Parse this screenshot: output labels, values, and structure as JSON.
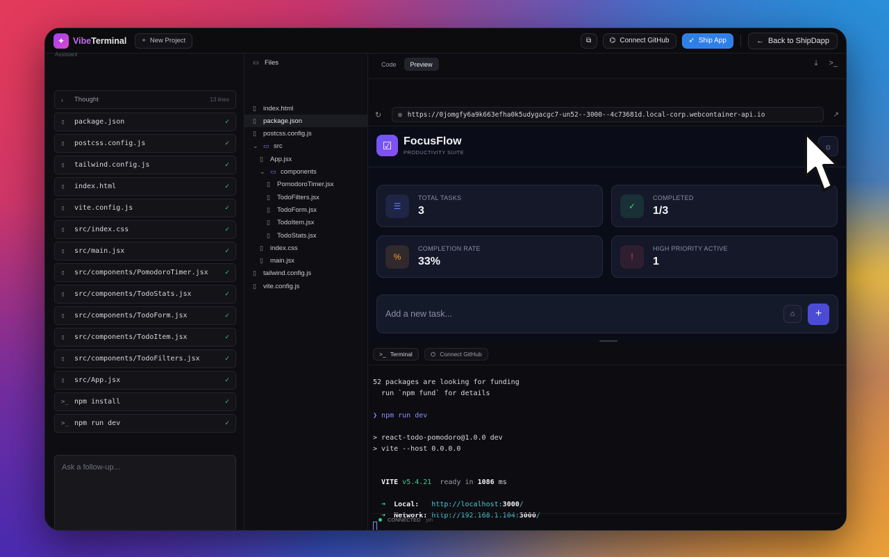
{
  "app": {
    "brand_prefix": "Vibe",
    "brand_suffix": "Terminal",
    "new_project": "New Project",
    "connect_github": "Connect GitHub",
    "ship_app": "Ship App",
    "back": "Back to ShipDapp"
  },
  "assistant": {
    "header": "Assistant",
    "thought_label": "Thought",
    "thought_lines": "13 lines",
    "items": [
      {
        "label": "package.json",
        "icon": "file-icon"
      },
      {
        "label": "postcss.config.js",
        "icon": "file-icon"
      },
      {
        "label": "tailwind.config.js",
        "icon": "file-icon"
      },
      {
        "label": "index.html",
        "icon": "file-icon"
      },
      {
        "label": "vite.config.js",
        "icon": "file-icon"
      },
      {
        "label": "src/index.css",
        "icon": "file-icon"
      },
      {
        "label": "src/main.jsx",
        "icon": "file-icon"
      },
      {
        "label": "src/components/PomodoroTimer.jsx",
        "icon": "file-icon"
      },
      {
        "label": "src/components/TodoStats.jsx",
        "icon": "file-icon"
      },
      {
        "label": "src/components/TodoForm.jsx",
        "icon": "file-icon"
      },
      {
        "label": "src/components/TodoItem.jsx",
        "icon": "file-icon"
      },
      {
        "label": "src/components/TodoFilters.jsx",
        "icon": "file-icon"
      },
      {
        "label": "src/App.jsx",
        "icon": "file-icon"
      },
      {
        "label": "npm install",
        "icon": "terminal-icon"
      },
      {
        "label": "npm run dev",
        "icon": "terminal-icon"
      }
    ],
    "followup_placeholder": "Ask a follow-up..."
  },
  "files": {
    "header": "Files",
    "tree": [
      {
        "label": "index.html",
        "type": "file",
        "depth": 0
      },
      {
        "label": "package.json",
        "type": "file",
        "depth": 0,
        "selected": true
      },
      {
        "label": "postcss.config.js",
        "type": "file",
        "depth": 0
      },
      {
        "label": "src",
        "type": "folder",
        "depth": 0
      },
      {
        "label": "App.jsx",
        "type": "file",
        "depth": 1
      },
      {
        "label": "components",
        "type": "folder",
        "depth": 1
      },
      {
        "label": "PomodoroTimer.jsx",
        "type": "file",
        "depth": 2
      },
      {
        "label": "TodoFilters.jsx",
        "type": "file",
        "depth": 2
      },
      {
        "label": "TodoForm.jsx",
        "type": "file",
        "depth": 2
      },
      {
        "label": "TodoItem.jsx",
        "type": "file",
        "depth": 2
      },
      {
        "label": "TodoStats.jsx",
        "type": "file",
        "depth": 2
      },
      {
        "label": "index.css",
        "type": "file",
        "depth": 1
      },
      {
        "label": "main.jsx",
        "type": "file",
        "depth": 1
      },
      {
        "label": "tailwind.config.js",
        "type": "file",
        "depth": 0
      },
      {
        "label": "vite.config.js",
        "type": "file",
        "depth": 0
      }
    ]
  },
  "preview": {
    "tab_code": "Code",
    "tab_preview": "Preview",
    "url": "https://0jomgfy6a9k663efha0k5udygacgc7-un52--3000--4c73681d.local-corp.webcontainer-api.io",
    "app_title": "FocusFlow",
    "app_subtitle": "PRODUCTIVITY SUITE",
    "stats": [
      {
        "label": "TOTAL TASKS",
        "value": "3",
        "icon": "list-icon",
        "color": "#6b7cff"
      },
      {
        "label": "COMPLETED",
        "value": "1/3",
        "icon": "check-circle-icon",
        "color": "#3fcf8e"
      },
      {
        "label": "COMPLETION RATE",
        "value": "33%",
        "icon": "percent-icon",
        "color": "#f0a040"
      },
      {
        "label": "HIGH PRIORITY ACTIVE",
        "value": "1",
        "icon": "alert-icon",
        "color": "#e04a5a"
      }
    ],
    "task_placeholder": "Add a new task..."
  },
  "terminal": {
    "tab_terminal": "Terminal",
    "tab_github": "Connect GitHub",
    "l1": "52 packages are looking for funding",
    "l2": "  run `npm fund` for details",
    "prompt": "❯ ",
    "cmd": "npm run dev",
    "l3": "> react-todo-pomodoro@1.0.0 dev",
    "l4": "> vite --host 0.0.0.0",
    "vite": "VITE",
    "vite_ver": "v5.4.21",
    "ready": "ready in",
    "ready_ms": "1086",
    "ms": "ms",
    "arrow": "➜",
    "local_lbl": "Local:",
    "local_url_a": "http://localhost:",
    "local_port": "3000",
    "net_lbl": "Network:",
    "net_url_a": "http://192.168.1.104:",
    "net_port": "3000",
    "slash": "/",
    "status": "CONNECTED",
    "shell": "jsh"
  },
  "colors": {
    "accent": "#2f7fe8",
    "brand": "#a43df0",
    "success": "#3fcf8e"
  }
}
